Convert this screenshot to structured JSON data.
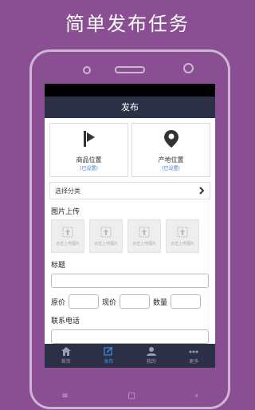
{
  "headline": "简单发布任务",
  "screen": {
    "title": "发布",
    "location_cards": [
      {
        "label": "商品位置",
        "sub": "(已设置)",
        "icon": "flag-icon"
      },
      {
        "label": "产地位置",
        "sub": "(已设置)",
        "icon": "map-pin-icon"
      }
    ],
    "category_select": "选择分类",
    "images_label": "图片上传",
    "upload_placeholder": "点击上传图片",
    "title_label": "标题",
    "price_original": "原价",
    "price_current": "现价",
    "quantity": "数量",
    "phone_label": "联系电话"
  },
  "tabs": [
    {
      "label": "首页",
      "icon": "home-icon"
    },
    {
      "label": "发布",
      "icon": "edit-icon"
    },
    {
      "label": "我的",
      "icon": "user-icon"
    },
    {
      "label": "更多",
      "icon": "more-icon"
    }
  ],
  "device_keys": [
    "≡",
    "□",
    "‹"
  ],
  "colors": {
    "background": "#8a4f92",
    "bar": "#2b3046",
    "accent": "#3a8ee6"
  }
}
